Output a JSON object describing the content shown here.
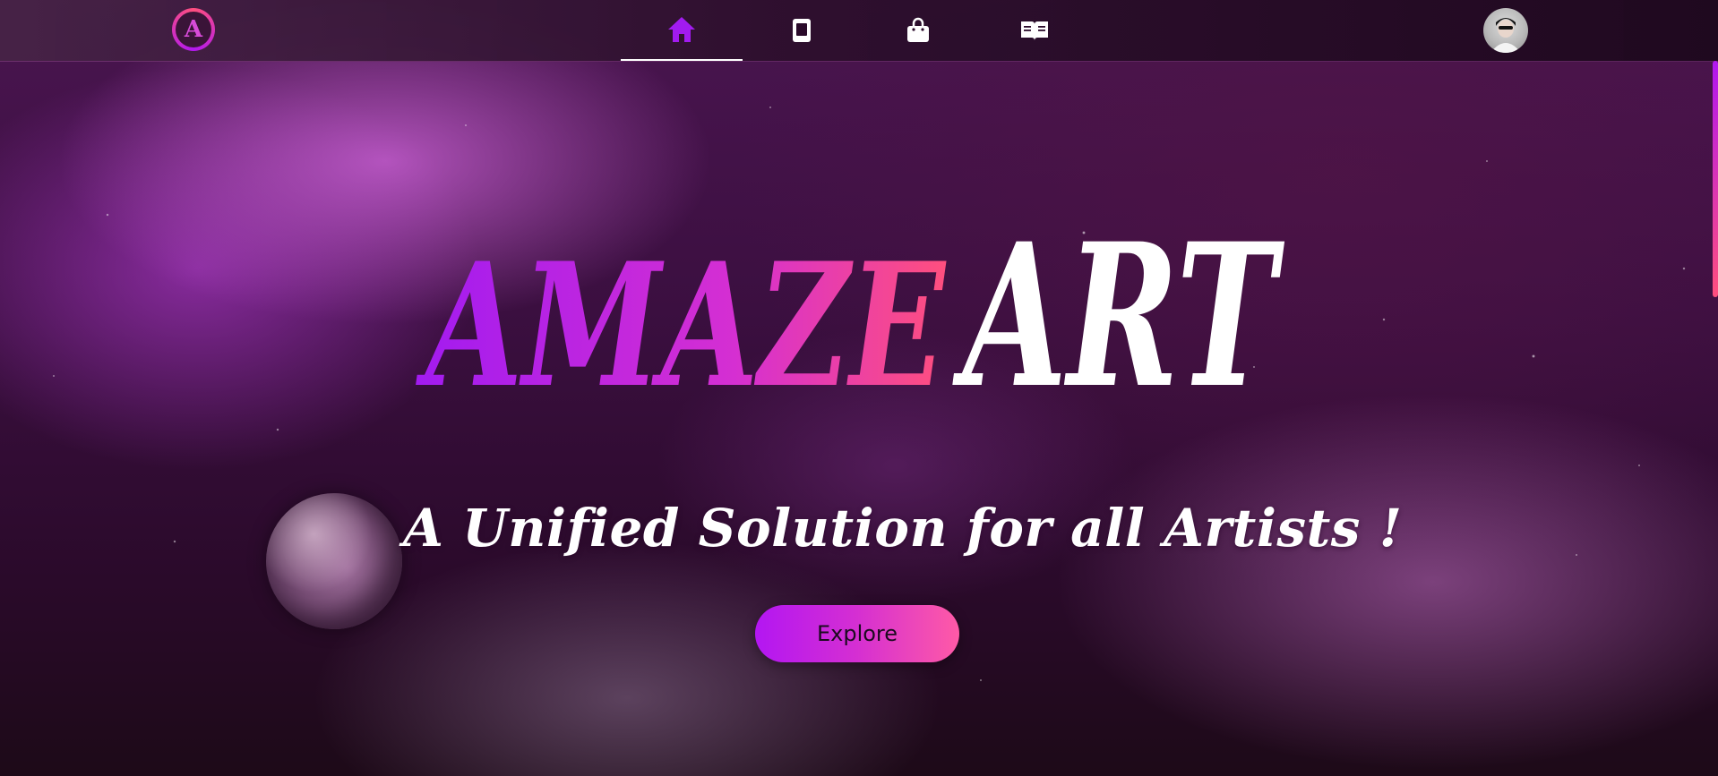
{
  "brand": {
    "logo_letter": "A",
    "name_part1": "AMAZE",
    "name_part2": "ART"
  },
  "nav": {
    "items": [
      {
        "name": "home",
        "icon": "home-icon",
        "active": true
      },
      {
        "name": "book",
        "icon": "book-icon",
        "active": false
      },
      {
        "name": "shop",
        "icon": "shopping-bag-icon",
        "active": false
      },
      {
        "name": "read",
        "icon": "open-book-icon",
        "active": false
      }
    ],
    "avatar_icon": "user-avatar"
  },
  "hero": {
    "tagline": "A Unified Solution for all Artists !",
    "explore_label": "Explore"
  },
  "colors": {
    "accent_purple": "#b316f2",
    "accent_pink": "#ff5aa6",
    "nav_active_icon": "#a21bf0",
    "nav_icon": "#ffffff",
    "title_white": "#ffffff"
  }
}
